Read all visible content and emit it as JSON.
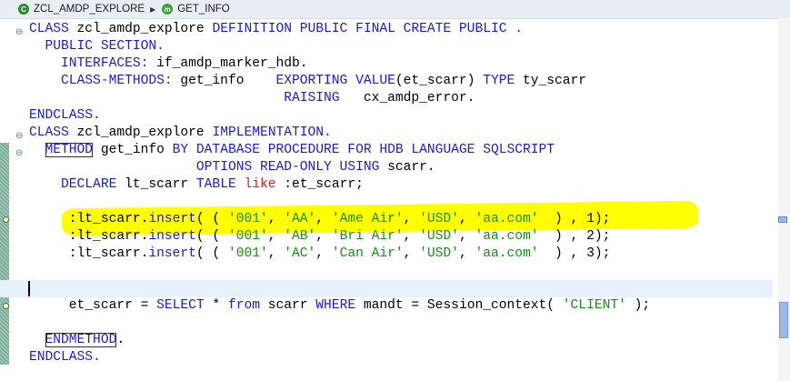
{
  "breadcrumb": {
    "class_icon": "class-icon",
    "class_name": "ZCL_AMDP_EXPLORE",
    "method_icon": "method-icon",
    "method_name": "GET_INFO"
  },
  "code": [
    {
      "parts": [
        {
          "t": "CLASS",
          "c": "kw"
        },
        {
          "t": " zcl_amdp_explore "
        },
        {
          "t": "DEFINITION PUBLIC FINAL CREATE PUBLIC .",
          "c": "kw"
        }
      ]
    },
    {
      "parts": [
        {
          "t": "  "
        },
        {
          "t": "PUBLIC SECTION.",
          "c": "kw"
        }
      ]
    },
    {
      "parts": [
        {
          "t": "    "
        },
        {
          "t": "INTERFACES:",
          "c": "kw"
        },
        {
          "t": " if_amdp_marker_hdb."
        }
      ]
    },
    {
      "parts": [
        {
          "t": "    "
        },
        {
          "t": "CLASS-METHODS:",
          "c": "kw"
        },
        {
          "t": " get_info    "
        },
        {
          "t": "EXPORTING VALUE",
          "c": "kw"
        },
        {
          "t": "(et_scarr) "
        },
        {
          "t": "TYPE",
          "c": "kw"
        },
        {
          "t": " ty_scarr"
        }
      ]
    },
    {
      "parts": [
        {
          "t": "                                "
        },
        {
          "t": "RAISING",
          "c": "kw"
        },
        {
          "t": "   cx_amdp_error."
        }
      ]
    },
    {
      "parts": [
        {
          "t": "ENDCLASS.",
          "c": "kw"
        }
      ]
    },
    {
      "parts": [
        {
          "t": "CLASS",
          "c": "kw"
        },
        {
          "t": " zcl_amdp_explore "
        },
        {
          "t": "IMPLEMENTATION.",
          "c": "kw"
        }
      ]
    },
    {
      "parts": [
        {
          "t": "  "
        },
        {
          "t": "METHOD",
          "c": "kw boxed"
        },
        {
          "t": " get_info "
        },
        {
          "t": "BY DATABASE PROCEDURE FOR HDB LANGUAGE SQLSCRIPT",
          "c": "kw"
        }
      ]
    },
    {
      "parts": [
        {
          "t": "                     "
        },
        {
          "t": "OPTIONS READ-ONLY USING",
          "c": "kw"
        },
        {
          "t": " scarr."
        }
      ]
    },
    {
      "parts": [
        {
          "t": "    "
        },
        {
          "t": "DECLARE",
          "c": "kw"
        },
        {
          "t": " lt_scarr "
        },
        {
          "t": "TABLE",
          "c": "kw"
        },
        {
          "t": " "
        },
        {
          "t": "like",
          "c": "red"
        },
        {
          "t": " :et_scarr;"
        }
      ]
    },
    {
      "parts": []
    },
    {
      "parts": [
        {
          "t": "     :lt_scarr."
        },
        {
          "t": "insert",
          "c": "kw"
        },
        {
          "t": "( ( "
        },
        {
          "t": "'001'",
          "c": "str"
        },
        {
          "t": ", "
        },
        {
          "t": "'AA'",
          "c": "str"
        },
        {
          "t": ", "
        },
        {
          "t": "'Ame Air'",
          "c": "str"
        },
        {
          "t": ", "
        },
        {
          "t": "'USD'",
          "c": "str"
        },
        {
          "t": ", "
        },
        {
          "t": "'aa.com'",
          "c": "str"
        },
        {
          "t": "  ) , 1);"
        }
      ]
    },
    {
      "parts": [
        {
          "t": "     :lt_scarr."
        },
        {
          "t": "insert",
          "c": "kw"
        },
        {
          "t": "( ( "
        },
        {
          "t": "'001'",
          "c": "str"
        },
        {
          "t": ", "
        },
        {
          "t": "'AB'",
          "c": "str"
        },
        {
          "t": ", "
        },
        {
          "t": "'Bri Air'",
          "c": "str"
        },
        {
          "t": ", "
        },
        {
          "t": "'USD'",
          "c": "str"
        },
        {
          "t": ", "
        },
        {
          "t": "'aa.com'",
          "c": "str"
        },
        {
          "t": "  ) , 2);"
        }
      ]
    },
    {
      "parts": [
        {
          "t": "     :lt_scarr."
        },
        {
          "t": "insert",
          "c": "kw"
        },
        {
          "t": "( ( "
        },
        {
          "t": "'001'",
          "c": "str"
        },
        {
          "t": ", "
        },
        {
          "t": "'AC'",
          "c": "str"
        },
        {
          "t": ", "
        },
        {
          "t": "'Can Air'",
          "c": "str"
        },
        {
          "t": ", "
        },
        {
          "t": "'USD'",
          "c": "str"
        },
        {
          "t": ", "
        },
        {
          "t": "'aa.com'",
          "c": "str"
        },
        {
          "t": "  ) , 3);"
        }
      ]
    },
    {
      "parts": []
    },
    {
      "parts": []
    },
    {
      "parts": [
        {
          "t": "     et_scarr = "
        },
        {
          "t": "SELECT",
          "c": "kw"
        },
        {
          "t": " * "
        },
        {
          "t": "from",
          "c": "kw"
        },
        {
          "t": " scarr "
        },
        {
          "t": "WHERE",
          "c": "kw"
        },
        {
          "t": " mandt = Session_context( "
        },
        {
          "t": "'CLIENT'",
          "c": "str"
        },
        {
          "t": " );"
        }
      ]
    },
    {
      "parts": []
    },
    {
      "parts": [
        {
          "t": "  "
        },
        {
          "t": "ENDMETHOD",
          "c": "kw boxed"
        },
        {
          "t": "."
        }
      ]
    },
    {
      "parts": [
        {
          "t": "ENDCLASS.",
          "c": "kw"
        }
      ]
    }
  ]
}
